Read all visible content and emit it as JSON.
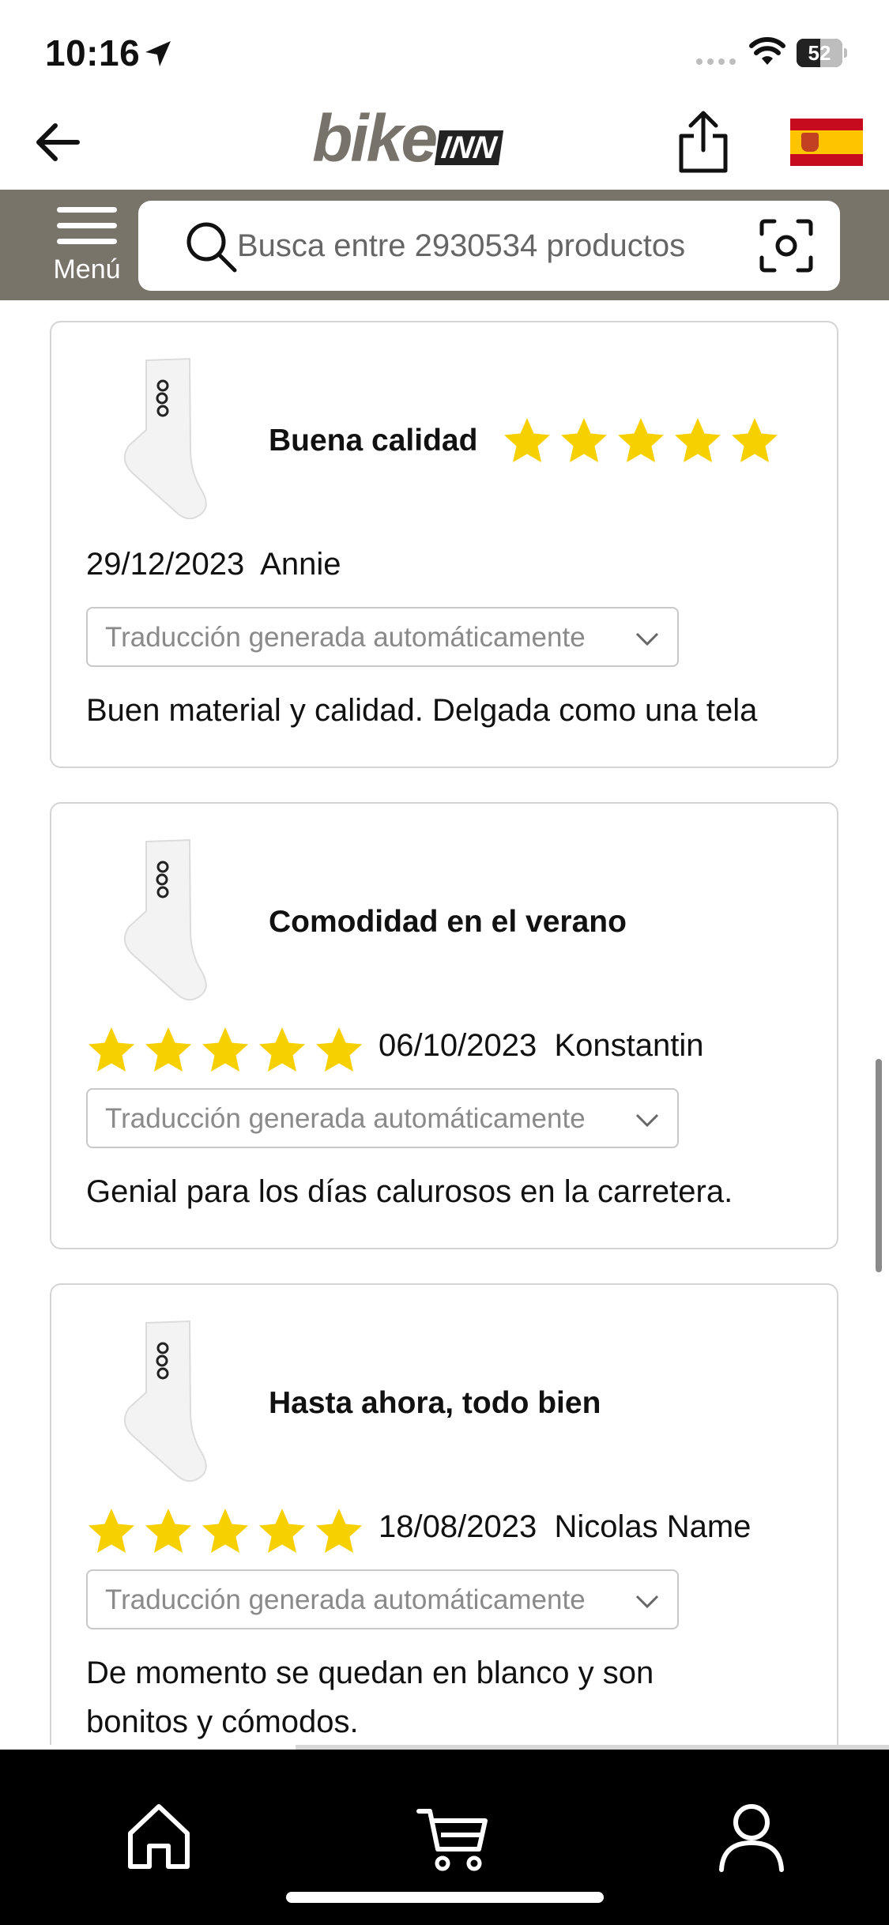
{
  "status_bar": {
    "time": "10:16",
    "battery_level": "52",
    "battery_fraction": 0.52
  },
  "header": {
    "logo_bike": "bike",
    "logo_inn": "INN",
    "back_icon": "arrow-left-icon",
    "share_icon": "share-icon",
    "flag": "spain-flag"
  },
  "search": {
    "menu_label": "Menú",
    "placeholder": "Busca entre 2930534 productos",
    "camera_icon": "camera-scan-icon"
  },
  "reviews": [
    {
      "title": "Buena calidad",
      "rating": 5,
      "date": "29/12/2023",
      "author": "Annie",
      "translation_label": "Traducción generada automáticamente",
      "text": "Buen material y calidad. Delgada como una tela"
    },
    {
      "title": "Comodidad en el verano",
      "rating": 5,
      "date": "06/10/2023",
      "author": "Konstantin",
      "translation_label": "Traducción generada automáticamente",
      "text": "Genial para los días calurosos en la carretera."
    },
    {
      "title": "Hasta ahora, todo bien",
      "rating": 5,
      "date": "18/08/2023",
      "author": "Nicolas Name",
      "translation_label": "Traducción generada automáticamente",
      "text": "De momento se quedan en blanco y son bonitos y cómodos."
    }
  ],
  "bottom_nav": {
    "items": [
      "home-icon",
      "cart-icon",
      "user-icon"
    ]
  },
  "colors": {
    "search_band": "#78746a",
    "star": "#f7d000",
    "logo_gray": "#77736a"
  }
}
